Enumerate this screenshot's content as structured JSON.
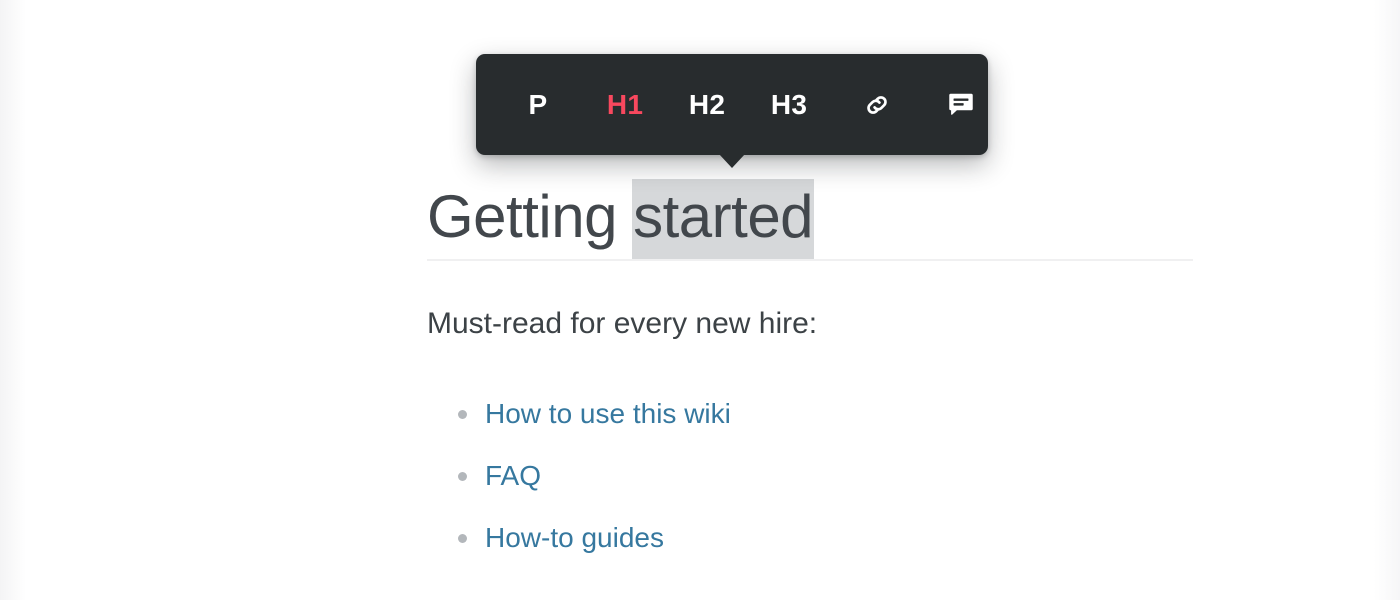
{
  "colors": {
    "toolbar_bg": "#282c2e",
    "active_accent": "#f8485e",
    "link": "#36789f",
    "heading_text": "#42474c",
    "body_text": "#3c4246",
    "selection_highlight": "#d6d8da",
    "bullet": "#b3b7bb",
    "rule": "#f0f0f1",
    "page_bg": "#ffffff"
  },
  "toolbar": {
    "name": "format-toolbar",
    "active_item": "H1",
    "items": [
      {
        "id": "paragraph",
        "label": "P",
        "type": "text",
        "active": false
      },
      {
        "id": "heading-1",
        "label": "H1",
        "type": "text",
        "active": true
      },
      {
        "id": "heading-2",
        "label": "H2",
        "type": "text",
        "active": false
      },
      {
        "id": "heading-3",
        "label": "H3",
        "type": "text",
        "active": false
      },
      {
        "id": "link",
        "label": "",
        "type": "icon",
        "icon": "link-icon",
        "active": false
      },
      {
        "id": "comment",
        "label": "",
        "type": "icon",
        "icon": "comment-icon",
        "active": false
      }
    ]
  },
  "document": {
    "heading": {
      "prefix": "Getting ",
      "selected": "started",
      "full_text": "Getting started"
    },
    "paragraph": "Must-read for every new hire:",
    "list": [
      {
        "label": "How to use this wiki"
      },
      {
        "label": "FAQ"
      },
      {
        "label": "How-to guides"
      }
    ]
  }
}
